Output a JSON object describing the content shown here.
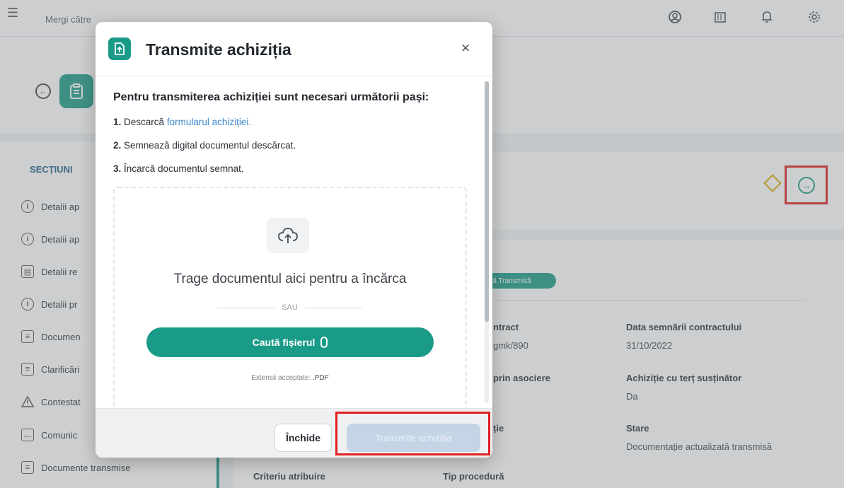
{
  "topbar": {
    "goto_label": "Mergi către",
    "goto_link": "",
    "icons": [
      "user-icon",
      "building-icon",
      "bell-icon",
      "settings-icon"
    ]
  },
  "sidebar": {
    "section_title": "SECȚIUNI",
    "items": [
      {
        "label": "Detalii ap",
        "icon": "info-icon"
      },
      {
        "label": "Detalii ap",
        "icon": "info-icon"
      },
      {
        "label": "Detalii re",
        "icon": "id-card-icon"
      },
      {
        "label": "Detalii pr",
        "icon": "info-icon"
      },
      {
        "label": "Documen",
        "icon": "document-icon"
      },
      {
        "label": "Clarificări",
        "icon": "clipboard-icon"
      },
      {
        "label": "Contestat",
        "icon": "warning-icon"
      },
      {
        "label": "Comunic",
        "icon": "chat-icon"
      },
      {
        "label": "Documente transmise",
        "icon": "document-icon"
      }
    ]
  },
  "details": {
    "status_pill": "ată Transmisă",
    "fields": [
      {
        "label": "ntract",
        "value": "gmk/890"
      },
      {
        "label": "Data semnării contractului",
        "value": "31/10/2022"
      },
      {
        "label": "prin asociere",
        "value": ""
      },
      {
        "label": "Achiziție cu terț susținător",
        "value": "Da"
      },
      {
        "label": "ție",
        "value": ""
      },
      {
        "label": "Stare",
        "value": "Documentație actualizată transmisă"
      },
      {
        "label": "Criteriu atribuire",
        "value": ""
      },
      {
        "label": "Tip procedură",
        "value": ""
      }
    ]
  },
  "modal": {
    "title": "Transmite achiziția",
    "intro": "Pentru transmiterea achiziției sunt necesari următorii pași:",
    "steps": [
      {
        "num": "1.",
        "text": "Descarcă ",
        "link": "formularul achiziției."
      },
      {
        "num": "2.",
        "text": "Semnează digital documentul descărcat."
      },
      {
        "num": "3.",
        "text": "Încarcă documentul semnat."
      }
    ],
    "dropzone": {
      "text": "Trage documentul aici pentru a încărca",
      "or": "SAU",
      "browse_label": "Caută fișierul",
      "ext_prefix": "Extensii acceptate: ",
      "ext_value": ".PDF"
    },
    "footer": {
      "close_label": "Închide",
      "submit_label": "Transmite achiziția"
    }
  },
  "colors": {
    "accent": "#1a9b88",
    "link": "#3a86c8",
    "highlight": "#e02020",
    "warning": "#e0a800"
  }
}
